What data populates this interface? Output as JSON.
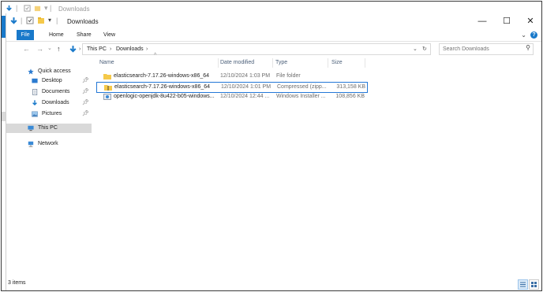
{
  "ghost_window": {
    "title": "Downloads",
    "partial_status": "3 i"
  },
  "window": {
    "title": "Downloads",
    "minimize_glyph": "—",
    "maximize_glyph": "☐",
    "close_glyph": "✕"
  },
  "ribbon": {
    "tabs": [
      {
        "label": "File"
      },
      {
        "label": "Home"
      },
      {
        "label": "Share"
      },
      {
        "label": "View"
      }
    ],
    "help_glyph": "?",
    "expand_glyph": "⌄"
  },
  "address_bar": {
    "segments": [
      "This PC",
      "Downloads"
    ],
    "separator": "›",
    "refresh_glyph": "↻"
  },
  "search": {
    "placeholder": "Search Downloads"
  },
  "nav_pane": {
    "items": [
      {
        "label": "Quick access",
        "icon": "star-icon",
        "pinned": false
      },
      {
        "label": "Desktop",
        "icon": "desktop-icon",
        "pinned": true
      },
      {
        "label": "Documents",
        "icon": "documents-icon",
        "pinned": true
      },
      {
        "label": "Downloads",
        "icon": "download-icon",
        "pinned": true
      },
      {
        "label": "Pictures",
        "icon": "pictures-icon",
        "pinned": true
      },
      {
        "label": "This PC",
        "icon": "computer-icon",
        "selected": true
      },
      {
        "label": "Network",
        "icon": "network-icon"
      }
    ]
  },
  "columns": [
    {
      "label": "Name"
    },
    {
      "label": "Date modified"
    },
    {
      "label": "Type"
    },
    {
      "label": "Size"
    }
  ],
  "files": [
    {
      "name": "elasticsearch-7.17.26-windows-x86_64",
      "date": "12/10/2024 1:03 PM",
      "type": "File folder",
      "size": "",
      "icon": "folder-icon",
      "selected": false
    },
    {
      "name": "elasticsearch-7.17.26-windows-x86_64",
      "date": "12/10/2024 1:01 PM",
      "type": "Compressed (zipp...",
      "size": "313,158 KB",
      "icon": "zip-folder-icon",
      "selected": true
    },
    {
      "name": "openlogic-openjdk-8u422-b05-windows...",
      "date": "12/10/2024 12:44 ...",
      "type": "Windows Installer ...",
      "size": "108,856 KB",
      "icon": "installer-icon",
      "selected": false
    }
  ],
  "status": {
    "item_count": "3 items"
  },
  "colors": {
    "accent": "#1979ca",
    "selection_border": "#2478d6",
    "folder": "#f5c94a"
  }
}
